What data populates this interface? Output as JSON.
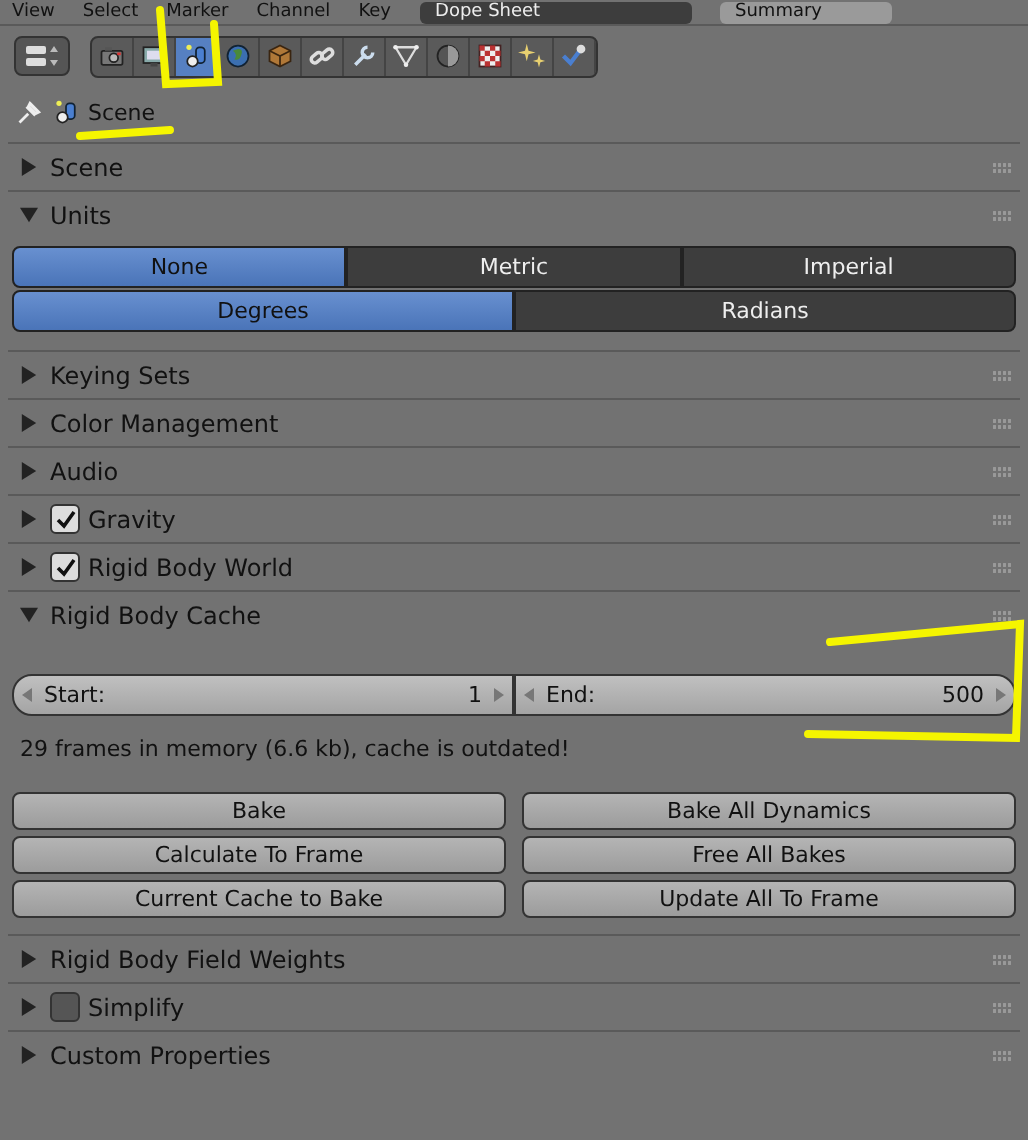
{
  "header": {
    "menus": [
      "View",
      "Select",
      "Marker",
      "Channel",
      "Key"
    ],
    "editor": "Dope Sheet",
    "mode": "Summary"
  },
  "toolbar": {
    "icons": [
      {
        "kind": "camera",
        "selected": false
      },
      {
        "kind": "monitor",
        "selected": false
      },
      {
        "kind": "scene",
        "selected": true
      },
      {
        "kind": "globe",
        "selected": false
      },
      {
        "kind": "cube",
        "selected": false
      },
      {
        "kind": "chain",
        "selected": false
      },
      {
        "kind": "wrench",
        "selected": false
      },
      {
        "kind": "triangle",
        "selected": false
      },
      {
        "kind": "sphere",
        "selected": false
      },
      {
        "kind": "checker",
        "selected": false
      },
      {
        "kind": "sparkle",
        "selected": false
      },
      {
        "kind": "check",
        "selected": false
      }
    ]
  },
  "path": {
    "label": "Scene"
  },
  "panels": [
    {
      "title": "Scene",
      "expanded": false
    },
    {
      "title": "Units",
      "expanded": true,
      "kind": "units",
      "rows": [
        [
          {
            "label": "None",
            "selected": true
          },
          {
            "label": "Metric",
            "selected": false
          },
          {
            "label": "Imperial",
            "selected": false
          }
        ],
        [
          {
            "label": "Degrees",
            "selected": true
          },
          {
            "label": "Radians",
            "selected": false
          }
        ]
      ]
    },
    {
      "title": "Keying Sets",
      "expanded": false
    },
    {
      "title": "Color Management",
      "expanded": false
    },
    {
      "title": "Audio",
      "expanded": false
    },
    {
      "title": "Gravity",
      "expanded": false,
      "checked": true
    },
    {
      "title": "Rigid Body World",
      "expanded": false,
      "checked": true
    },
    {
      "title": "Rigid Body Cache",
      "expanded": true,
      "kind": "cache",
      "fields": [
        {
          "label": "Start:",
          "value": "1"
        },
        {
          "label": "End:",
          "value": "500"
        }
      ],
      "info": "29 frames in memory (6.6 kb), cache is outdated!",
      "buttons": [
        "Bake",
        "Bake All Dynamics",
        "Calculate To Frame",
        "Free All Bakes",
        "Current Cache to Bake",
        "Update All To Frame"
      ]
    },
    {
      "title": "Rigid Body Field Weights",
      "expanded": false
    },
    {
      "title": "Simplify",
      "expanded": false,
      "checked": false
    },
    {
      "title": "Custom Properties",
      "expanded": false
    }
  ]
}
